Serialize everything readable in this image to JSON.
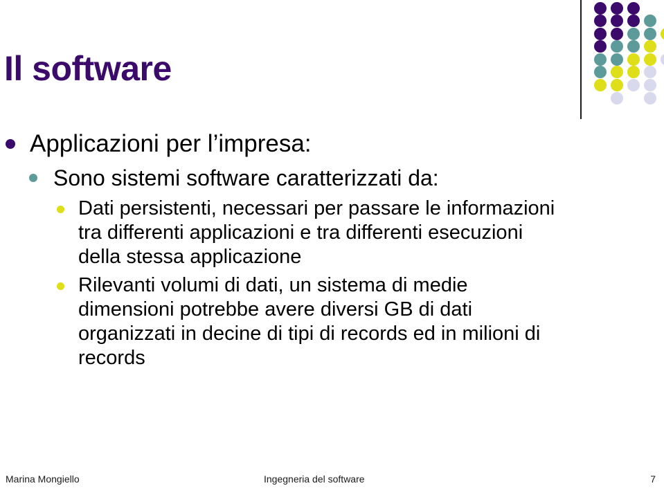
{
  "slide": {
    "title": "Il software",
    "title_color": "#3b0a6b",
    "background": "#ffffff"
  },
  "outline": [
    {
      "level": 1,
      "bullet_color": "#3b0a6b",
      "text": "Applicazioni per l’impresa:"
    },
    {
      "level": 2,
      "bullet_color": "#5d9a9a",
      "text": "Sono sistemi software caratterizzati da:"
    },
    {
      "level": 3,
      "bullet_color": "#dede19",
      "text": "Dati persistenti, necessari per passare le informazioni tra differenti applicazioni e tra differenti esecuzioni della stessa applicazione"
    },
    {
      "level": 3,
      "bullet_color": "#dede19",
      "text": "Rilevanti volumi di dati, un sistema di medie dimensioni potrebbe avere diversi GB di dati organizzati in decine di tipi di records ed in milioni di records"
    }
  ],
  "footer": {
    "author": "Marina Mongiello",
    "course": "Ingegneria del software",
    "page_number": "7"
  },
  "decoration": {
    "name": "dot-grid",
    "rule_color": "#1a1a1a",
    "palette": {
      "purple": "#3b0a6b",
      "teal": "#5d9a9a",
      "yellow": "#dede19",
      "lavender": "#d9d9ee"
    },
    "rows": [
      [
        "purple",
        "purple",
        "purple",
        "",
        ""
      ],
      [
        "purple",
        "purple",
        "purple",
        "teal",
        ""
      ],
      [
        "purple",
        "purple",
        "teal",
        "teal",
        "yellow"
      ],
      [
        "purple",
        "teal",
        "teal",
        "yellow",
        ""
      ],
      [
        "teal",
        "teal",
        "yellow",
        "yellow",
        "lavender"
      ],
      [
        "teal",
        "yellow",
        "yellow",
        "lavender",
        ""
      ],
      [
        "yellow",
        "yellow",
        "lavender",
        "lavender",
        ""
      ],
      [
        "",
        "lavender",
        "",
        "lavender",
        ""
      ]
    ]
  }
}
